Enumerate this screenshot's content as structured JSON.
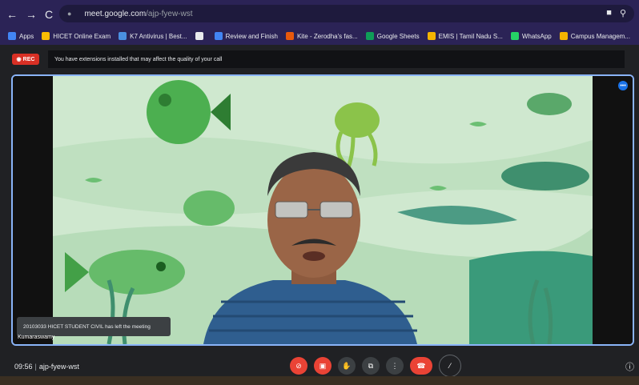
{
  "browser": {
    "url_host": "meet.google.com",
    "url_path": "/ajp-fyew-wst",
    "nav": {
      "back": "←",
      "forward": "→",
      "reload": "C"
    },
    "bookmarks": [
      {
        "label": "Apps",
        "color": "#4285f4"
      },
      {
        "label": "HICET Online Exam",
        "color": "#fbbc04"
      },
      {
        "label": "K7 Antivirus | Best...",
        "color": "#4a90e2"
      },
      {
        "label": "",
        "color": "#e8eaed"
      },
      {
        "label": "Review and Finish",
        "color": "#4285f4"
      },
      {
        "label": "Kite - Zerodha's fas...",
        "color": "#e8590c"
      },
      {
        "label": "Google Sheets",
        "color": "#0f9d58"
      },
      {
        "label": "EMIS | Tamil Nadu S...",
        "color": "#f4b400"
      },
      {
        "label": "WhatsApp",
        "color": "#25d366"
      },
      {
        "label": "Campus Managem...",
        "color": "#f4b400"
      }
    ]
  },
  "meet": {
    "rec_label": "REC",
    "extensions_warning": "You have extensions installed that may affect the quality of your call",
    "toast": "20103033 HICET STUDENT CIVIL has left the meeting",
    "participant_name": "Kumaraswamy",
    "time": "09:56",
    "meeting_code": "ajp-fyew-wst",
    "colors": {
      "accent": "#8ab4f8",
      "end_call": "#ea4335"
    }
  }
}
